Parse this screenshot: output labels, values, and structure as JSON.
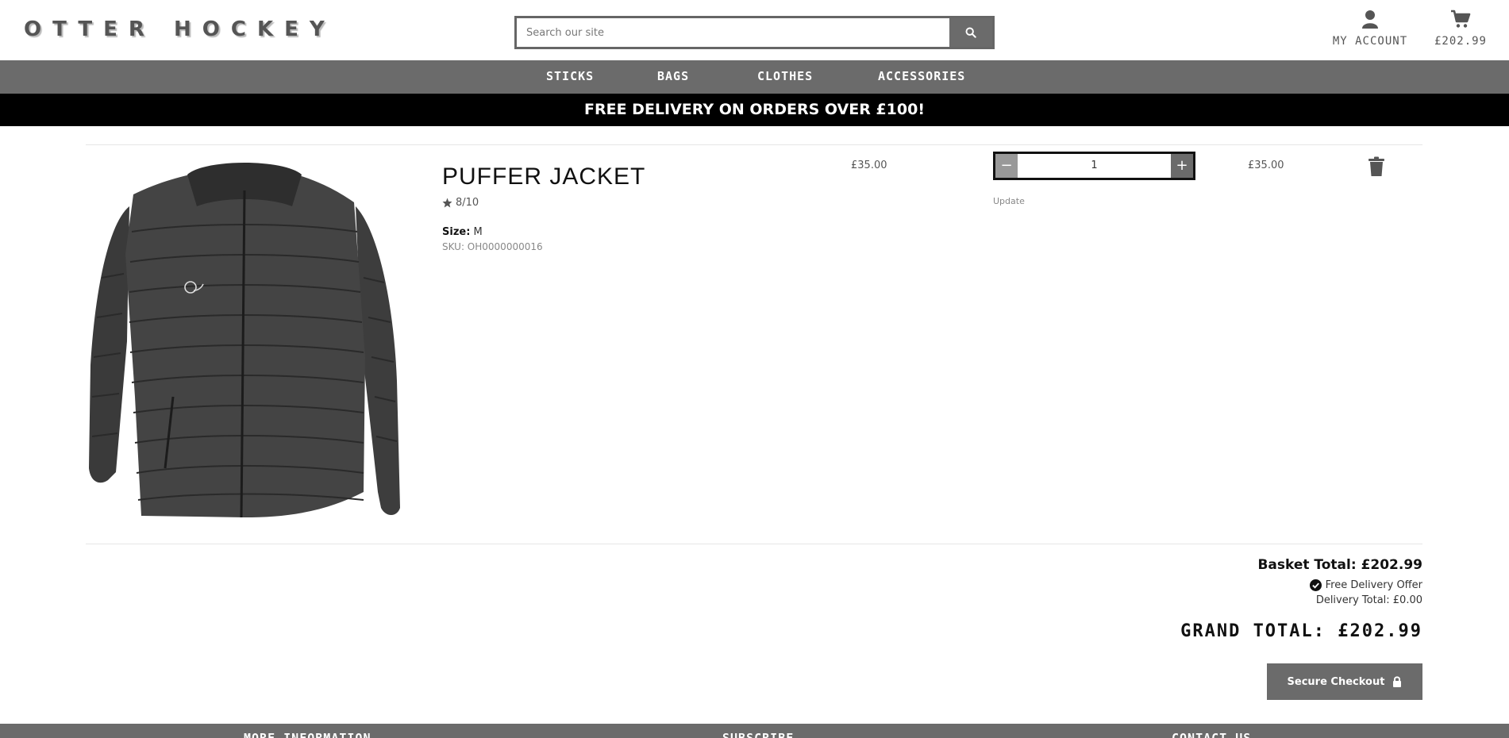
{
  "header": {
    "logo": "OTTER HOCKEY",
    "search_placeholder": "Search our site",
    "account_label": "MY ACCOUNT",
    "basket_total": "£202.99"
  },
  "nav": {
    "items": [
      "STICKS",
      "BAGS",
      "CLOTHES",
      "ACCESSORIES"
    ]
  },
  "banner": "FREE DELIVERY ON ORDERS OVER £100!",
  "basket": {
    "items": [
      {
        "name": "PUFFER JACKET",
        "rating": "8/10",
        "size_label": "Size:",
        "size": "M",
        "sku": "SKU: OH0000000016",
        "price": "£35.00",
        "quantity": "1",
        "update_label": "Update",
        "subtotal": "£35.00"
      }
    ]
  },
  "totals": {
    "basket_total": "Basket Total: £202.99",
    "free_delivery": "Free Delivery Offer",
    "delivery_total": "Delivery Total: £0.00",
    "grand_total": "GRAND TOTAL: £202.99",
    "checkout_label": "Secure Checkout"
  },
  "footer": {
    "headings": [
      "MORE INFORMATION",
      "SUBSCRIBE",
      "CONTACT US"
    ]
  },
  "colors": {
    "accent_grey": "#6b6b6b",
    "banner_bg": "#000000"
  }
}
